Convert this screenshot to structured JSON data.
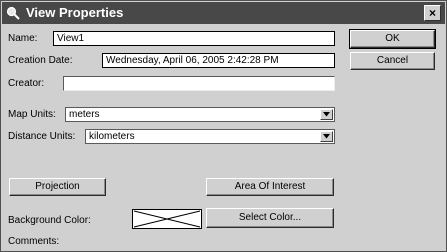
{
  "window": {
    "title": "View Properties",
    "close_label": "×"
  },
  "form": {
    "name_label": "Name:",
    "name_value": "View1",
    "creation_date_label": "Creation Date:",
    "creation_date_value": "Wednesday, April 06, 2005 2:42:28 PM",
    "creator_label": "Creator:",
    "creator_value": "",
    "map_units_label": "Map Units:",
    "map_units_value": "meters",
    "distance_units_label": "Distance Units:",
    "distance_units_value": "kilometers",
    "background_color_label": "Background Color:",
    "comments_label": "Comments:"
  },
  "buttons": {
    "ok": "OK",
    "cancel": "Cancel",
    "projection": "Projection",
    "area_of_interest": "Area Of Interest",
    "select_color": "Select Color..."
  },
  "icons": {
    "title": "magnifier-icon",
    "dropdown": "chevron-down-icon"
  }
}
